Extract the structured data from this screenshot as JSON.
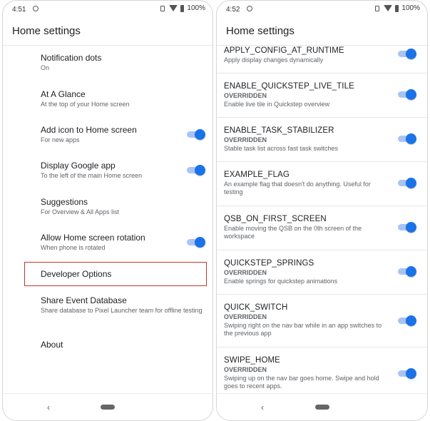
{
  "left": {
    "status": {
      "time": "4:51",
      "battery": "100%"
    },
    "title": "Home settings",
    "items": [
      {
        "title": "Notification dots",
        "subtitle": "On",
        "toggle": false
      },
      {
        "title": "At A Glance",
        "subtitle": "At the top of your Home screen",
        "toggle": false
      },
      {
        "title": "Add icon to Home screen",
        "subtitle": "For new apps",
        "toggle": true
      },
      {
        "title": "Display Google app",
        "subtitle": "To the left of the main Home screen",
        "toggle": true
      },
      {
        "title": "Suggestions",
        "subtitle": "For Overview & All Apps list",
        "toggle": false
      },
      {
        "title": "Allow Home screen rotation",
        "subtitle": "When phone is rotated",
        "toggle": true
      },
      {
        "title": "Developer Options",
        "subtitle": "",
        "toggle": false,
        "highlighted": true
      },
      {
        "title": "Share Event Database",
        "subtitle": "Share database to Pixel Launcher team for offline testing",
        "toggle": false
      },
      {
        "title": "About",
        "subtitle": "",
        "toggle": false
      }
    ]
  },
  "right": {
    "status": {
      "time": "4:52",
      "battery": "100%"
    },
    "title": "Home settings",
    "flags": [
      {
        "name": "APPLY_CONFIG_AT_RUNTIME",
        "overridden": "",
        "description": "Apply display changes dynamically",
        "enabled": true
      },
      {
        "name": "ENABLE_QUICKSTEP_LIVE_TILE",
        "overridden": "OVERRIDDEN",
        "description": "Enable live tile in Quickstep overview",
        "enabled": true
      },
      {
        "name": "ENABLE_TASK_STABILIZER",
        "overridden": "OVERRIDDEN",
        "description": "Stable task list across fast task switches",
        "enabled": true
      },
      {
        "name": "EXAMPLE_FLAG",
        "overridden": "",
        "description": "An example flag that doesn't do anything. Useful for testing",
        "enabled": true
      },
      {
        "name": "QSB_ON_FIRST_SCREEN",
        "overridden": "",
        "description": "Enable moving the QSB on the 0th screen of the workspace",
        "enabled": true
      },
      {
        "name": "QUICKSTEP_SPRINGS",
        "overridden": "OVERRIDDEN",
        "description": "Enable springs for quickstep animations",
        "enabled": true
      },
      {
        "name": "QUICK_SWITCH",
        "overridden": "OVERRIDDEN",
        "description": "Swiping right on the nav bar while in an app switches to the previous app",
        "enabled": true
      },
      {
        "name": "SWIPE_HOME",
        "overridden": "OVERRIDDEN",
        "description": "Swiping up on the nav bar goes home. Swipe and hold goes to recent apps.",
        "enabled": true
      }
    ]
  },
  "nav": {
    "back_glyph": "‹"
  },
  "colors": {
    "accent": "#1a73e8",
    "track": "#a7c4f7",
    "highlight": "#c0392b"
  }
}
